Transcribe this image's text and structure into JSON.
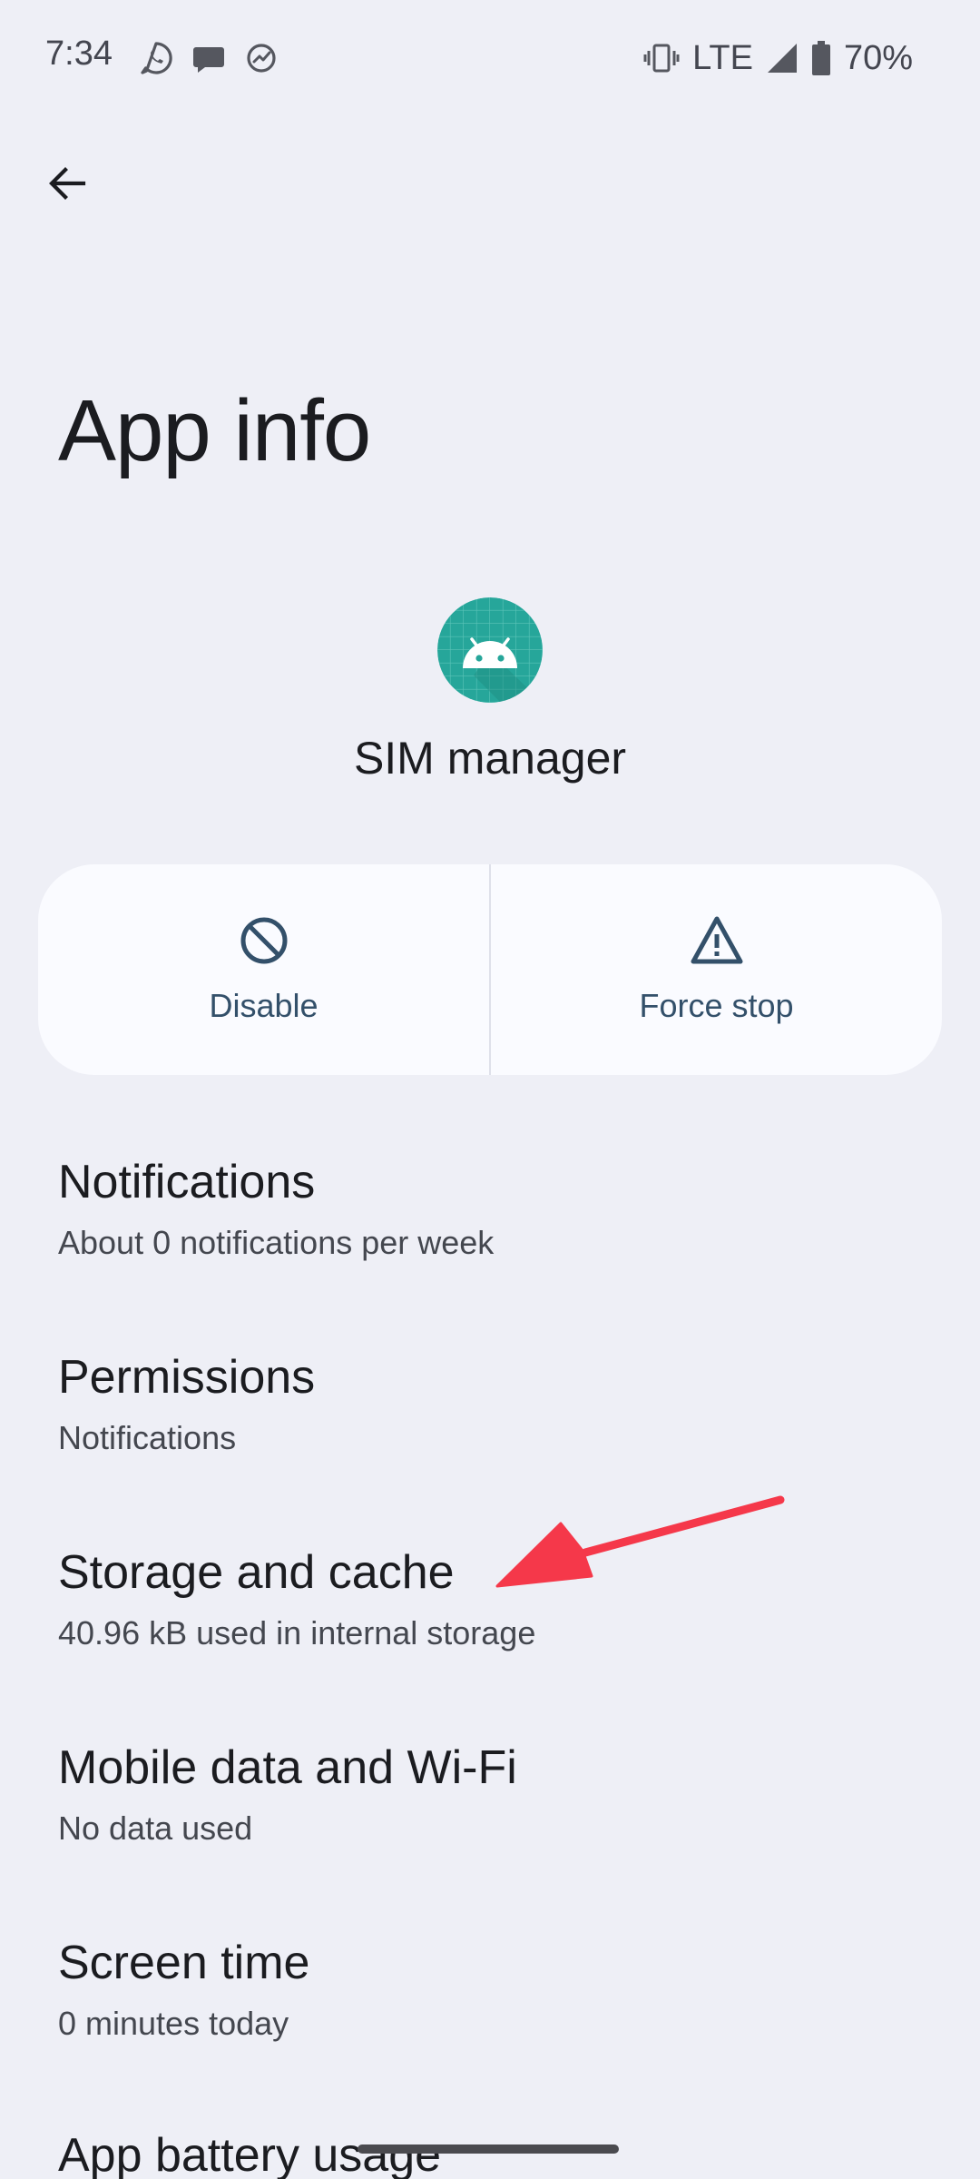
{
  "status_bar": {
    "time": "7:34",
    "network": "LTE",
    "battery": "70%",
    "notification_icons": [
      "whatsapp-icon",
      "messages-icon",
      "speedometer-icon"
    ],
    "system_icons": [
      "vibrate-icon",
      "signal-icon",
      "battery-icon"
    ]
  },
  "header": {
    "back_icon": "arrow-back-icon",
    "title": "App info"
  },
  "app": {
    "name": "SIM manager",
    "icon": "android-icon",
    "icon_color": "#26a69a"
  },
  "actions": [
    {
      "label": "Disable",
      "icon": "disable-icon"
    },
    {
      "label": "Force stop",
      "icon": "warning-icon"
    }
  ],
  "settings": [
    {
      "title": "Notifications",
      "summary": "About 0 notifications per week"
    },
    {
      "title": "Permissions",
      "summary": "Notifications"
    },
    {
      "title": "Storage and cache",
      "summary": "40.96 kB used in internal storage"
    },
    {
      "title": "Mobile data and Wi-Fi",
      "summary": "No data used"
    },
    {
      "title": "Screen time",
      "summary": "0 minutes today"
    },
    {
      "title": "App battery usage",
      "summary": ""
    }
  ],
  "annotation": {
    "color": "#f5384a",
    "points_to": "Storage and cache"
  },
  "colors": {
    "background": "#eeeff6",
    "card": "#fafbff",
    "action_accent": "#33506a"
  }
}
